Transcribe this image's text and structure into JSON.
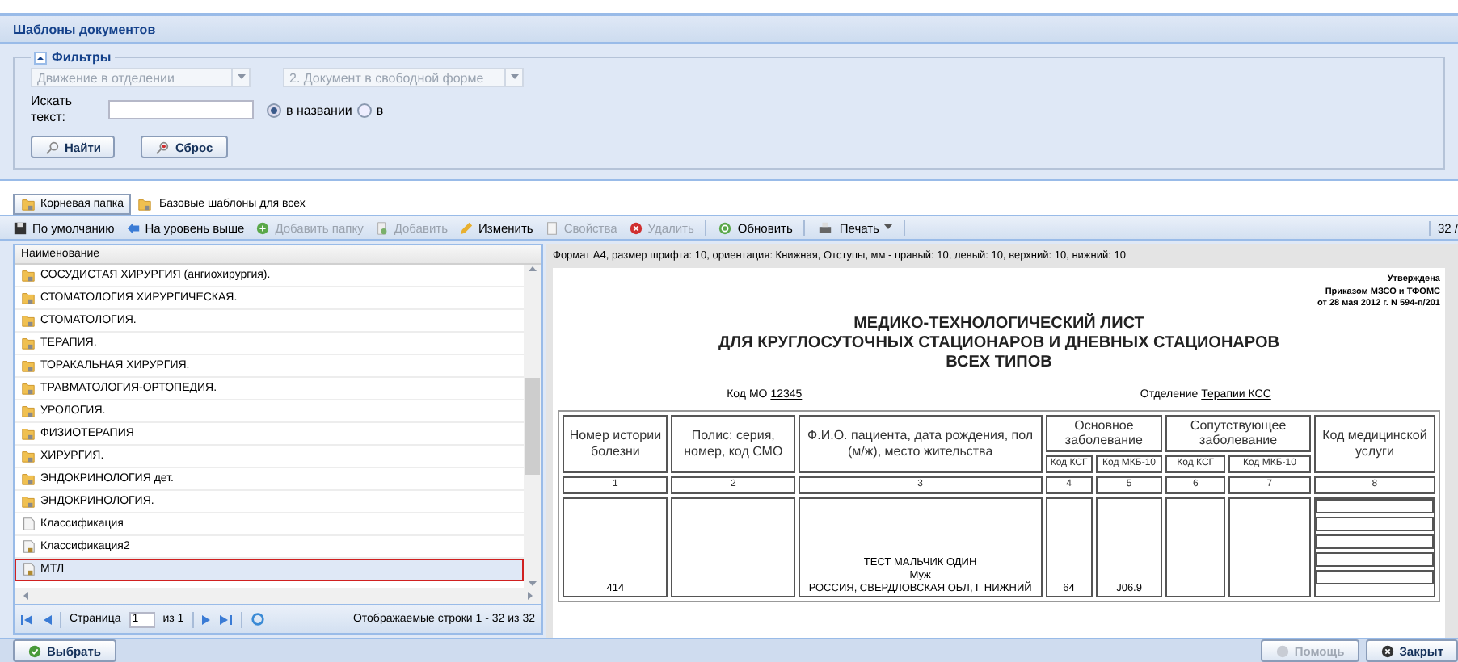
{
  "window": {
    "title": "Шаблоны документов"
  },
  "filters": {
    "legend": "Фильтры",
    "expanded": true,
    "combos": [
      {
        "value": "Движение в отделении",
        "disabled": true
      },
      {
        "value": "2. Документ в свободной форме",
        "disabled": true
      }
    ],
    "search_label": "Искать текст:",
    "radios": [
      {
        "label": "в названии",
        "selected": true
      },
      {
        "label": "в",
        "selected": false
      }
    ],
    "buttons": [
      {
        "label": "Найти",
        "kind": "search"
      },
      {
        "label": "Сброс",
        "kind": "reset"
      }
    ]
  },
  "breadcrumb": [
    {
      "label": "Корневая папка",
      "kind": "button"
    },
    {
      "label": "Базовые шаблоны для всех",
      "kind": "current"
    }
  ],
  "toolbar": {
    "items": [
      {
        "label": "По умолчанию",
        "kind": "save",
        "disabled": false
      },
      {
        "label": "На уровень выше",
        "kind": "up",
        "disabled": false
      },
      {
        "label": "Добавить папку",
        "kind": "add",
        "disabled": true
      },
      {
        "label": "Добавить",
        "kind": "adddoc",
        "disabled": true
      },
      {
        "label": "Изменить",
        "kind": "edit",
        "disabled": false
      },
      {
        "label": "Свойства",
        "kind": "props",
        "disabled": true
      },
      {
        "label": "Удалить",
        "kind": "delete",
        "disabled": true
      },
      {
        "label": "Обновить",
        "kind": "refresh",
        "disabled": false
      },
      {
        "label": "Печать",
        "kind": "print",
        "disabled": false
      }
    ],
    "count": "32 /"
  },
  "tree": {
    "column": "Наименование",
    "rows": [
      {
        "label": "СОСУДИСТАЯ ХИРУРГИЯ (ангиохирургия).",
        "kind": "folder",
        "selected": false
      },
      {
        "label": "СТОМАТОЛОГИЯ ХИРУРГИЧЕСКАЯ.",
        "kind": "folder",
        "selected": false
      },
      {
        "label": "СТОМАТОЛОГИЯ.",
        "kind": "folder",
        "selected": false
      },
      {
        "label": "ТЕРАПИЯ.",
        "kind": "folder",
        "selected": false
      },
      {
        "label": "ТОРАКАЛЬНАЯ ХИРУРГИЯ.",
        "kind": "folder",
        "selected": false
      },
      {
        "label": "ТРАВМАТОЛОГИЯ-ОРТОПЕДИЯ.",
        "kind": "folder",
        "selected": false
      },
      {
        "label": "УРОЛОГИЯ.",
        "kind": "folder",
        "selected": false
      },
      {
        "label": "ФИЗИОТЕРАПИЯ",
        "kind": "folder",
        "selected": false
      },
      {
        "label": "ХИРУРГИЯ.",
        "kind": "folder",
        "selected": false
      },
      {
        "label": "ЭНДОКРИНОЛОГИЯ дет.",
        "kind": "folder",
        "selected": false
      },
      {
        "label": "ЭНДОКРИНОЛОГИЯ.",
        "kind": "folder",
        "selected": false
      },
      {
        "label": "Классификация",
        "kind": "document",
        "selected": false
      },
      {
        "label": "Классификация2",
        "kind": "locked",
        "selected": false
      },
      {
        "label": "МТЛ",
        "kind": "locked",
        "selected": true
      }
    ]
  },
  "pager": {
    "page_label": "Страница",
    "page": "1",
    "of": "из 1",
    "summary": "Отображаемые строки 1 - 32 из 32"
  },
  "preview": {
    "format": "Формат А4, размер шрифта: 10, ориентация: Книжная, Отступы, мм - правый: 10, левый: 10, верхний: 10, нижний: 10",
    "approval": [
      "Утверждена",
      "Приказом МЗСО и ТФОМС",
      "от 28 мая 2012 г. N 594-п/201"
    ],
    "title": [
      "МЕДИКО-ТЕХНОЛОГИЧЕСКИЙ ЛИСТ",
      "ДЛЯ КРУГЛОСУТОЧНЫХ СТАЦИОНАРОВ И ДНЕВНЫХ СТАЦИОНАРОВ",
      "ВСЕХ ТИПОВ"
    ],
    "mo_label": "Код МО",
    "mo_value": "12345",
    "dept_label": "Отделение",
    "dept_value": "Терапии КСС",
    "columns": [
      {
        "label": "Номер истории болезни"
      },
      {
        "label": "Полис: серия, номер, код СМО"
      },
      {
        "label": "Ф.И.О. пациента, дата рождения, пол (м/ж), место жительства"
      },
      {
        "label": "Основное заболевание",
        "sub": [
          "Код КСГ",
          "Код МКБ-10"
        ]
      },
      {
        "label": "Сопутствующее заболевание",
        "sub": [
          "Код КСГ",
          "Код МКБ-10"
        ]
      },
      {
        "label": "Код медицинской услуги"
      }
    ],
    "numbers": [
      "1",
      "2",
      "3",
      "4",
      "5",
      "6",
      "7",
      "8"
    ],
    "row": {
      "history": "414",
      "patient": [
        "ТЕСТ МАЛЬЧИК ОДИН",
        "Муж",
        "РОССИЯ, СВЕРДЛОВСКАЯ ОБЛ, Г НИЖНИЙ"
      ],
      "ksg": "64",
      "mkb": "J06.9"
    }
  },
  "footer": {
    "left": [
      {
        "label": "Выбрать",
        "kind": "ok",
        "disabled": false
      }
    ],
    "right": [
      {
        "label": "Помощь",
        "kind": "help",
        "disabled": true
      },
      {
        "label": "Закрыт",
        "kind": "close",
        "disabled": false
      }
    ]
  }
}
